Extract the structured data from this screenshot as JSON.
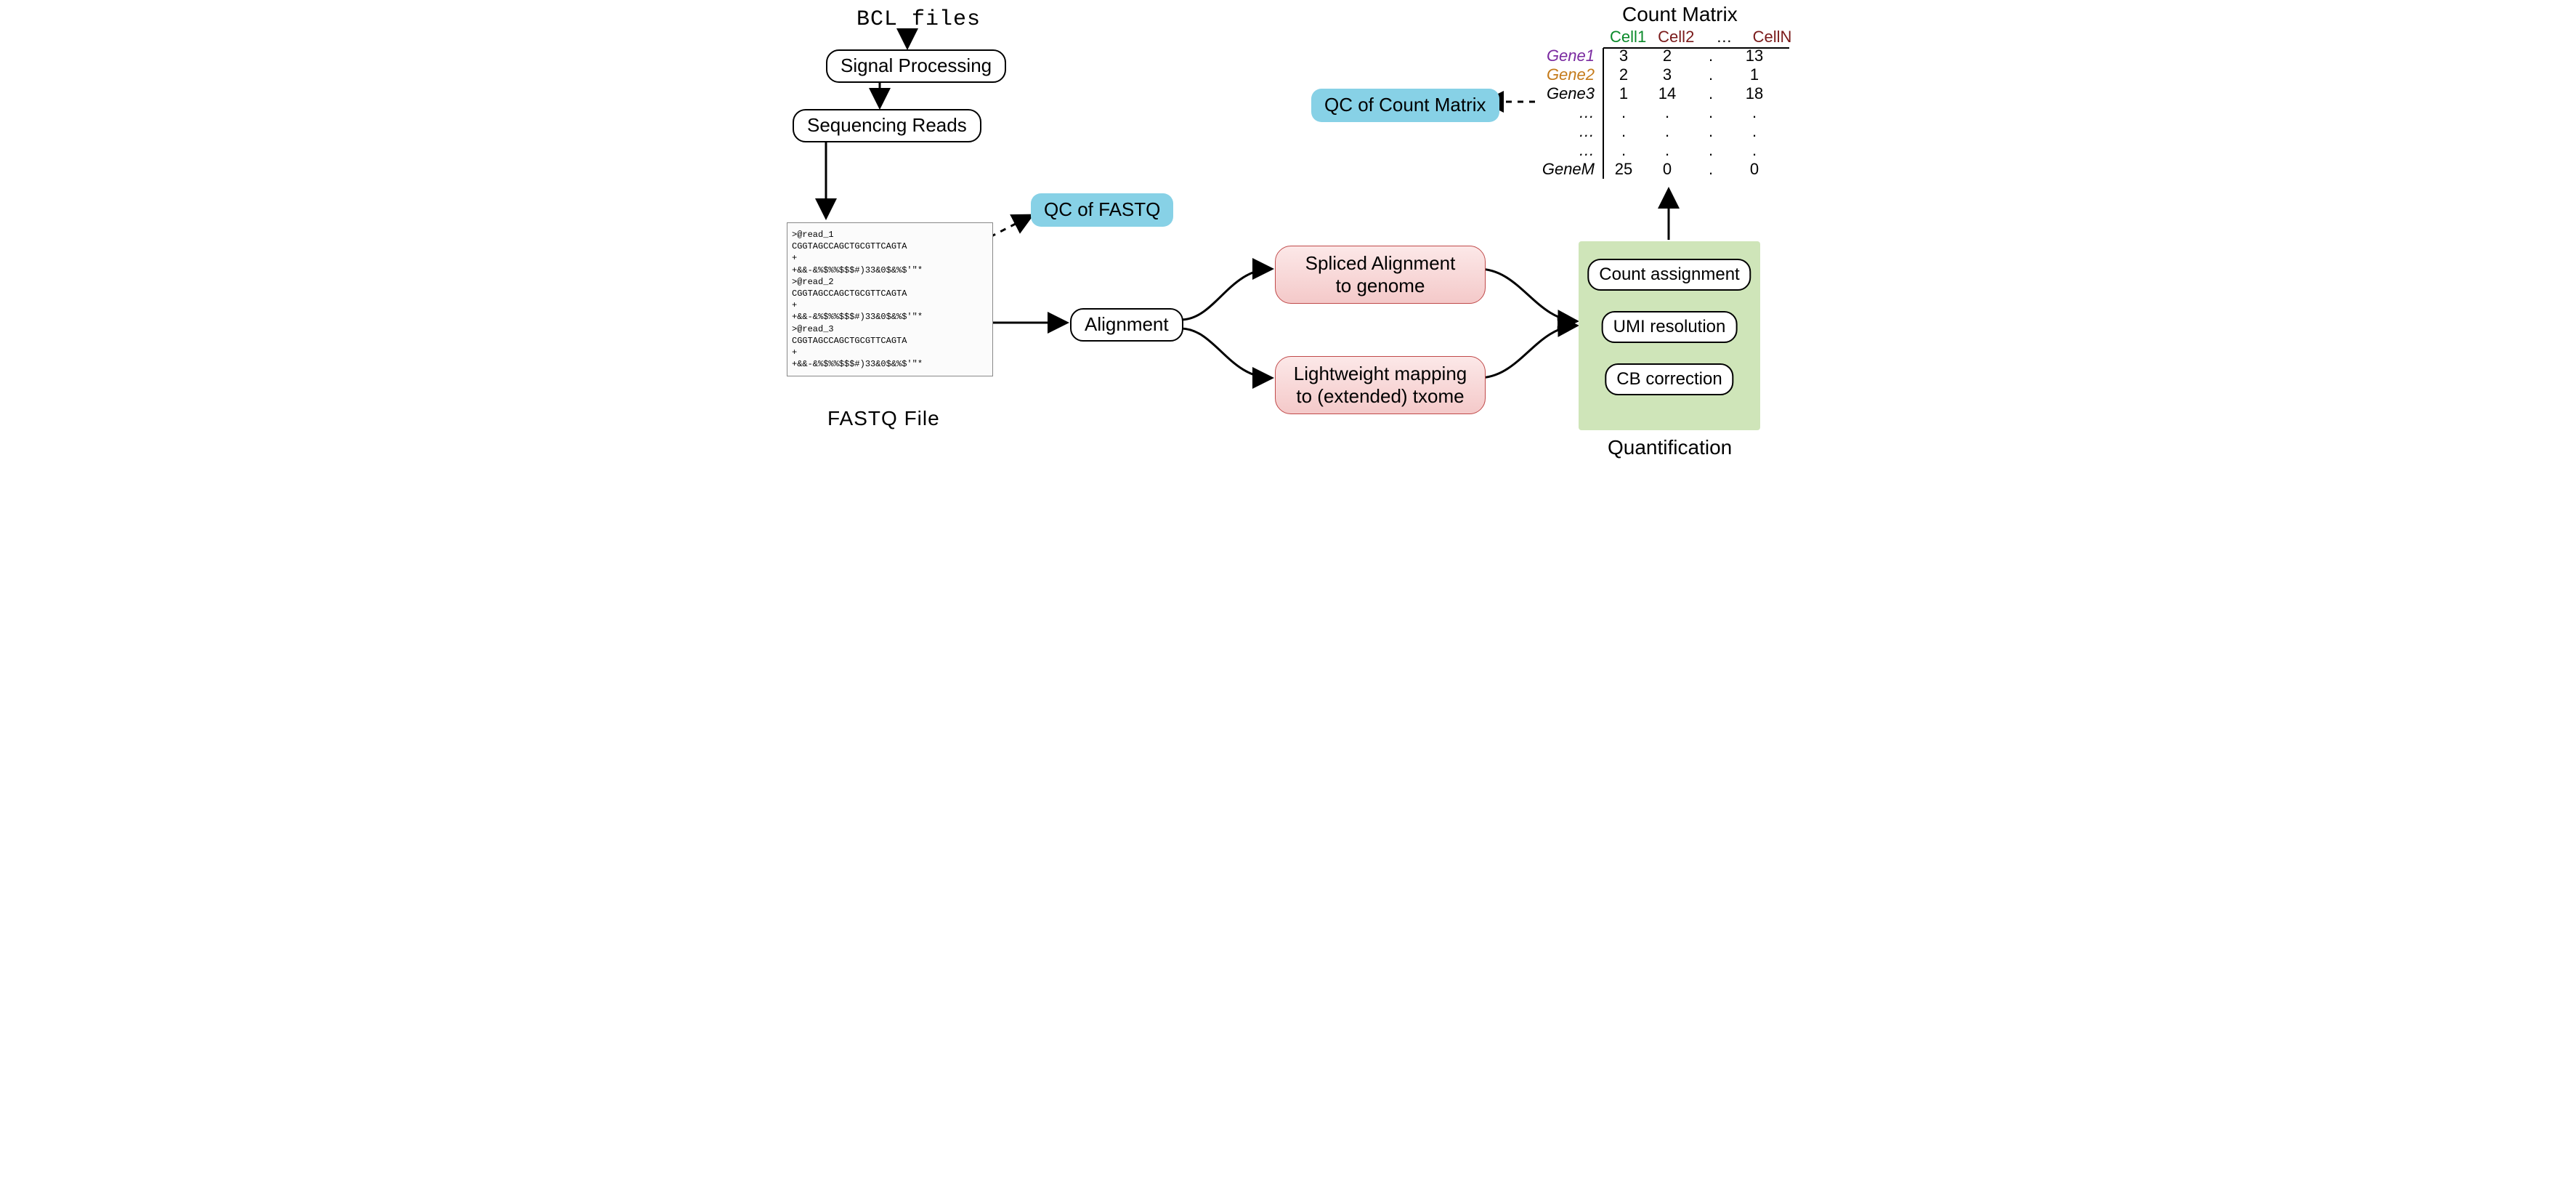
{
  "top_input": "BCL files",
  "steps": {
    "signal": "Signal Processing",
    "seqreads": "Sequencing Reads",
    "alignment": "Alignment",
    "spliced": "Spliced Alignment\nto genome",
    "lightweight": "Lightweight mapping\nto (extended) txome",
    "qc_fastq": "QC of FASTQ",
    "qc_matrix": "QC of Count Matrix"
  },
  "fastq_label": "FASTQ File",
  "quant_label": "Quantification",
  "quant_steps": {
    "cb": "CB correction",
    "umi": "UMI resolution",
    "count": "Count assignment"
  },
  "fastq_lines": [
    ">@read_1",
    "CGGTAGCCAGCTGCGTTCAGTA",
    "+",
    "+&&-&%$%%$$$#)33&0$&%$'\"*",
    ">@read_2",
    "CGGTAGCCAGCTGCGTTCAGTA",
    "+",
    "+&&-&%$%%$$$#)33&0$&%$'\"*",
    ">@read_3",
    "CGGTAGCCAGCTGCGTTCAGTA",
    "+",
    "+&&-&%$%%$$$#)33&0$&%$'\"*"
  ],
  "matrix": {
    "title": "Count Matrix",
    "col_headers": [
      "Cell1",
      "Cell2",
      "…",
      "CellN"
    ],
    "col_colors": [
      "#0a8a2a",
      "#7a1a1a",
      "#000",
      "#7a1a1a"
    ],
    "row_labels": [
      "Gene1",
      "Gene2",
      "Gene3",
      "…",
      "…",
      "…",
      "GeneM"
    ],
    "row_colors": [
      "#7a2aa0",
      "#c47a1a",
      "#000",
      "#000",
      "#000",
      "#000",
      "#000"
    ],
    "rows": [
      [
        "3",
        "2",
        ".",
        "13"
      ],
      [
        "2",
        "3",
        ".",
        "1"
      ],
      [
        "1",
        "14",
        ".",
        "18"
      ],
      [
        ".",
        ".",
        ".",
        "."
      ],
      [
        ".",
        ".",
        ".",
        "."
      ],
      [
        ".",
        ".",
        ".",
        "."
      ],
      [
        "25",
        "0",
        ".",
        "0"
      ]
    ]
  }
}
